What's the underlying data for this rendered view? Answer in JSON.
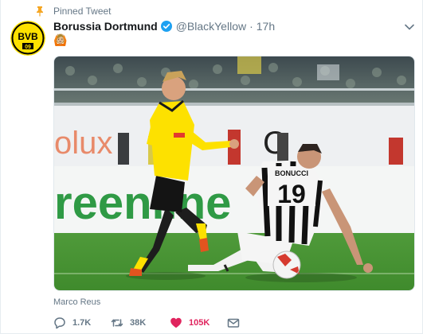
{
  "pinned": {
    "label": "Pinned Tweet",
    "icon": "pin-icon"
  },
  "account": {
    "name": "Borussia Dortmund",
    "handle": "@BlackYellow",
    "separator": "·",
    "time": "17h",
    "verified": true,
    "avatar_text": "BVB",
    "avatar_year": "09"
  },
  "tweet": {
    "emoji": "🙆🏼",
    "media_caption": "Marco Reus"
  },
  "photo": {
    "sign_left": "olux",
    "sign_right": "C",
    "banner_text": "reenline",
    "player_back_name": "BONUCCI",
    "player_back_number": "19"
  },
  "actions": {
    "reply_count": "1.7K",
    "retweet_count": "38K",
    "like_count": "105K"
  },
  "colors": {
    "bvb_yellow": "#fde100",
    "like_red": "#e0245e",
    "verified_blue": "#1da1f2",
    "muted": "#657786",
    "pin_gold": "#f5a623"
  }
}
